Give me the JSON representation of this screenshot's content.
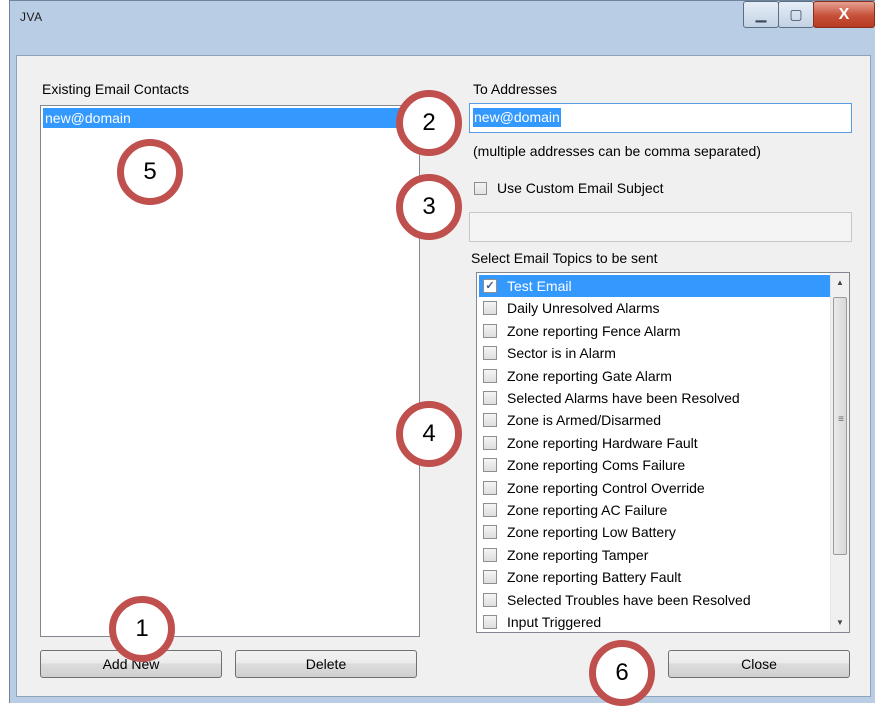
{
  "window": {
    "title": "JVA",
    "minimize_glyph": "▁",
    "maximize_glyph": "▢",
    "close_glyph": "X"
  },
  "contacts": {
    "label": "Existing Email Contacts",
    "items": [
      "new@domain"
    ]
  },
  "to_addresses": {
    "label": "To Addresses",
    "value": "new@domain",
    "hint": "(multiple addresses can be comma separated)"
  },
  "custom_subject": {
    "label": "Use Custom Email Subject",
    "checked": false,
    "value": ""
  },
  "topics": {
    "label": "Select Email Topics to be sent",
    "items": [
      {
        "label": "Test Email",
        "checked": true,
        "selected": true
      },
      {
        "label": "Daily Unresolved Alarms",
        "checked": false
      },
      {
        "label": "Zone reporting Fence Alarm",
        "checked": false
      },
      {
        "label": "Sector is in Alarm",
        "checked": false
      },
      {
        "label": "Zone reporting Gate Alarm",
        "checked": false
      },
      {
        "label": "Selected Alarms have been Resolved",
        "checked": false
      },
      {
        "label": "Zone is Armed/Disarmed",
        "checked": false
      },
      {
        "label": "Zone reporting Hardware Fault",
        "checked": false
      },
      {
        "label": "Zone reporting Coms Failure",
        "checked": false
      },
      {
        "label": "Zone reporting Control Override",
        "checked": false
      },
      {
        "label": "Zone reporting AC Failure",
        "checked": false
      },
      {
        "label": "Zone reporting Low Battery",
        "checked": false
      },
      {
        "label": "Zone reporting Tamper",
        "checked": false
      },
      {
        "label": "Zone reporting Battery Fault",
        "checked": false
      },
      {
        "label": "Selected Troubles have been Resolved",
        "checked": false
      },
      {
        "label": "Input Triggered",
        "checked": false
      }
    ]
  },
  "buttons": {
    "add_new": "Add New",
    "delete": "Delete",
    "close": "Close"
  },
  "markers": [
    "1",
    "2",
    "3",
    "4",
    "5",
    "6"
  ],
  "colors": {
    "selection": "#3399ff",
    "marker_ring": "#c0504d",
    "close_button": "#c75039"
  }
}
